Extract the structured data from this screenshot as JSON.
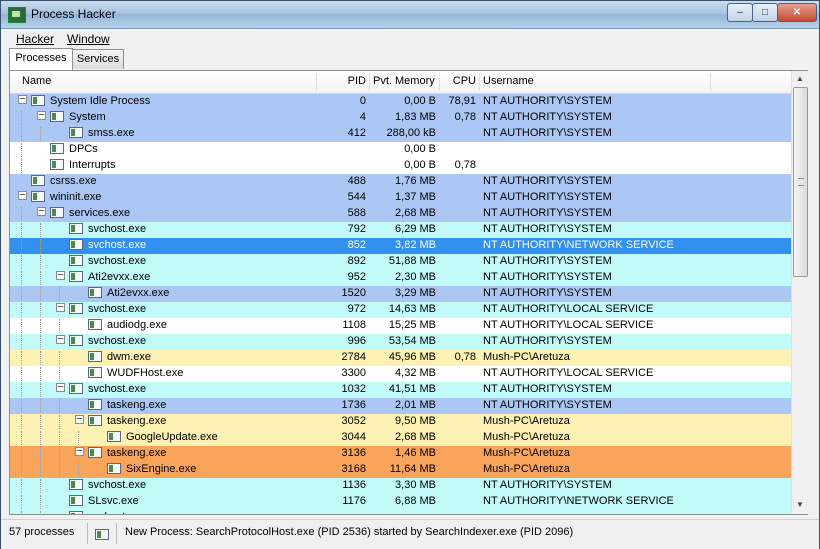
{
  "window": {
    "title": "Process Hacker",
    "icon": "process-hacker-icon",
    "controls": [
      "minimize",
      "maximize",
      "close"
    ]
  },
  "menu": {
    "items": [
      "Hacker",
      "Window"
    ]
  },
  "tabs": [
    {
      "label": "Processes",
      "active": true
    },
    {
      "label": "Services",
      "active": false
    }
  ],
  "columns": {
    "name": "Name",
    "pid": "PID",
    "memory": "Pvt. Memory",
    "cpu": "CPU",
    "username": "Username"
  },
  "colors": {
    "system": "#adc7f5",
    "service": "#c2fafa",
    "selected": "#3290ef",
    "user": "#fdf1b4",
    "highlight": "#f9a45b",
    "plain": "#ffffff"
  },
  "processes": [
    {
      "name": "System Idle Process",
      "pid": "0",
      "mem": "0,00 B",
      "cpu": "78,91",
      "user": "NT AUTHORITY\\SYSTEM",
      "level": 0,
      "expandable": true,
      "color": "system"
    },
    {
      "name": "System",
      "pid": "4",
      "mem": "1,83 MB",
      "cpu": "0,78",
      "user": "NT AUTHORITY\\SYSTEM",
      "level": 1,
      "expandable": true,
      "color": "system"
    },
    {
      "name": "smss.exe",
      "pid": "412",
      "mem": "288,00 kB",
      "cpu": "",
      "user": "NT AUTHORITY\\SYSTEM",
      "level": 2,
      "expandable": false,
      "color": "system"
    },
    {
      "name": "DPCs",
      "pid": "",
      "mem": "0,00 B",
      "cpu": "",
      "user": "",
      "level": 1,
      "expandable": false,
      "color": "plain"
    },
    {
      "name": "Interrupts",
      "pid": "",
      "mem": "0,00 B",
      "cpu": "0,78",
      "user": "",
      "level": 1,
      "expandable": false,
      "color": "plain"
    },
    {
      "name": "csrss.exe",
      "pid": "488",
      "mem": "1,76 MB",
      "cpu": "",
      "user": "NT AUTHORITY\\SYSTEM",
      "level": 0,
      "expandable": false,
      "color": "system"
    },
    {
      "name": "wininit.exe",
      "pid": "544",
      "mem": "1,37 MB",
      "cpu": "",
      "user": "NT AUTHORITY\\SYSTEM",
      "level": 0,
      "expandable": true,
      "color": "system"
    },
    {
      "name": "services.exe",
      "pid": "588",
      "mem": "2,68 MB",
      "cpu": "",
      "user": "NT AUTHORITY\\SYSTEM",
      "level": 1,
      "expandable": true,
      "color": "system"
    },
    {
      "name": "svchost.exe",
      "pid": "792",
      "mem": "6,29 MB",
      "cpu": "",
      "user": "NT AUTHORITY\\SYSTEM",
      "level": 2,
      "expandable": false,
      "color": "service"
    },
    {
      "name": "svchost.exe",
      "pid": "852",
      "mem": "3,82 MB",
      "cpu": "",
      "user": "NT AUTHORITY\\NETWORK SERVICE",
      "level": 2,
      "expandable": false,
      "color": "selected"
    },
    {
      "name": "svchost.exe",
      "pid": "892",
      "mem": "51,88 MB",
      "cpu": "",
      "user": "NT AUTHORITY\\SYSTEM",
      "level": 2,
      "expandable": false,
      "color": "service"
    },
    {
      "name": "Ati2evxx.exe",
      "pid": "952",
      "mem": "2,30 MB",
      "cpu": "",
      "user": "NT AUTHORITY\\SYSTEM",
      "level": 2,
      "expandable": true,
      "color": "service"
    },
    {
      "name": "Ati2evxx.exe",
      "pid": "1520",
      "mem": "3,29 MB",
      "cpu": "",
      "user": "NT AUTHORITY\\SYSTEM",
      "level": 3,
      "expandable": false,
      "color": "system"
    },
    {
      "name": "svchost.exe",
      "pid": "972",
      "mem": "14,63 MB",
      "cpu": "",
      "user": "NT AUTHORITY\\LOCAL SERVICE",
      "level": 2,
      "expandable": true,
      "color": "service"
    },
    {
      "name": "audiodg.exe",
      "pid": "1108",
      "mem": "15,25 MB",
      "cpu": "",
      "user": "NT AUTHORITY\\LOCAL SERVICE",
      "level": 3,
      "expandable": false,
      "color": "plain"
    },
    {
      "name": "svchost.exe",
      "pid": "996",
      "mem": "53,54 MB",
      "cpu": "",
      "user": "NT AUTHORITY\\SYSTEM",
      "level": 2,
      "expandable": true,
      "color": "service"
    },
    {
      "name": "dwm.exe",
      "pid": "2784",
      "mem": "45,96 MB",
      "cpu": "0,78",
      "user": "Mush-PC\\Aretuza",
      "level": 3,
      "expandable": false,
      "color": "user"
    },
    {
      "name": "WUDFHost.exe",
      "pid": "3300",
      "mem": "4,32 MB",
      "cpu": "",
      "user": "NT AUTHORITY\\LOCAL SERVICE",
      "level": 3,
      "expandable": false,
      "color": "plain"
    },
    {
      "name": "svchost.exe",
      "pid": "1032",
      "mem": "41,51 MB",
      "cpu": "",
      "user": "NT AUTHORITY\\SYSTEM",
      "level": 2,
      "expandable": true,
      "color": "service"
    },
    {
      "name": "taskeng.exe",
      "pid": "1736",
      "mem": "2,01 MB",
      "cpu": "",
      "user": "NT AUTHORITY\\SYSTEM",
      "level": 3,
      "expandable": false,
      "color": "system"
    },
    {
      "name": "taskeng.exe",
      "pid": "3052",
      "mem": "9,50 MB",
      "cpu": "",
      "user": "Mush-PC\\Aretuza",
      "level": 3,
      "expandable": true,
      "color": "user"
    },
    {
      "name": "GoogleUpdate.exe",
      "pid": "3044",
      "mem": "2,68 MB",
      "cpu": "",
      "user": "Mush-PC\\Aretuza",
      "level": 4,
      "expandable": false,
      "color": "user",
      "icon": "google-update-icon"
    },
    {
      "name": "taskeng.exe",
      "pid": "3136",
      "mem": "1,46 MB",
      "cpu": "",
      "user": "Mush-PC\\Aretuza",
      "level": 3,
      "expandable": true,
      "color": "highlight"
    },
    {
      "name": "SixEngine.exe",
      "pid": "3168",
      "mem": "11,64 MB",
      "cpu": "",
      "user": "Mush-PC\\Aretuza",
      "level": 4,
      "expandable": false,
      "color": "highlight",
      "icon": "sixengine-icon"
    },
    {
      "name": "svchost.exe",
      "pid": "1136",
      "mem": "3,30 MB",
      "cpu": "",
      "user": "NT AUTHORITY\\SYSTEM",
      "level": 2,
      "expandable": false,
      "color": "service"
    },
    {
      "name": "SLsvc.exe",
      "pid": "1176",
      "mem": "6,88 MB",
      "cpu": "",
      "user": "NT AUTHORITY\\NETWORK SERVICE",
      "level": 2,
      "expandable": false,
      "color": "service"
    },
    {
      "name": "svchost.exe",
      "pid": "",
      "mem": "",
      "cpu": "",
      "user": "",
      "level": 2,
      "expandable": false,
      "color": "service"
    }
  ],
  "status": {
    "count": "57 processes",
    "message": "New Process: SearchProtocolHost.exe (PID 2536) started by SearchIndexer.exe (PID 2096)"
  }
}
